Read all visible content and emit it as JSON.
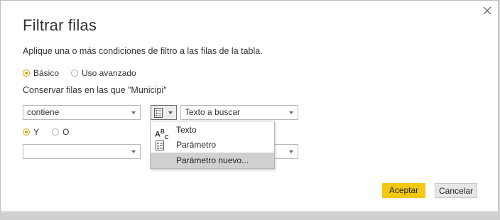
{
  "dialog": {
    "title": "Filtrar filas",
    "description": "Aplique una o más condiciones de filtro a las filas de la tabla.",
    "mode_basic": "Básico",
    "mode_advanced": "Uso avanzado",
    "keep_rows_label": "Conservar filas en las que \"Municipi\""
  },
  "row1": {
    "operator_value": "contiene",
    "value_placeholder": "Texto a buscar"
  },
  "logic": {
    "and_label": "Y",
    "or_label": "O"
  },
  "row2": {
    "operator_value": "",
    "value_value": ""
  },
  "type_menu": {
    "items": [
      {
        "label": "Texto",
        "icon": "abc-text-icon"
      },
      {
        "label": "Parámetro",
        "icon": "parameter-icon"
      },
      {
        "label": "Parámetro nuevo...",
        "icon": ""
      }
    ]
  },
  "buttons": {
    "accept": "Aceptar",
    "cancel": "Cancelar"
  },
  "colors": {
    "accent": "#f2c811",
    "radio_selected": "#d4a400",
    "menu_highlight": "#d0d0d0"
  }
}
